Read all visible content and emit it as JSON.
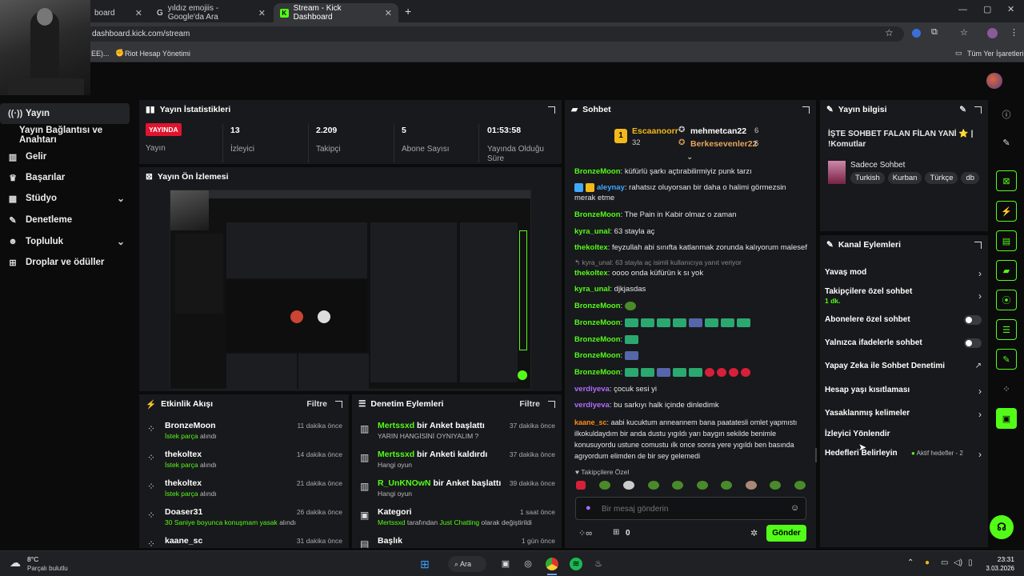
{
  "browser": {
    "tabs": [
      {
        "title": "board"
      },
      {
        "title": "yıldız emojiis - Google'da Ara"
      },
      {
        "title": "Stream - Kick Dashboard"
      }
    ],
    "url": "dashboard.kick.com/stream",
    "bookmarks": [
      "EE)...",
      "Riot Hesap Yönetimi"
    ],
    "bookmarks_right": "Tüm Yer İşaretleri"
  },
  "nav": {
    "items": [
      {
        "label": "Yayın",
        "icon": "broadcast-icon"
      },
      {
        "label": "Yayın Bağlantısı ve Anahtarı",
        "icon": ""
      },
      {
        "label": "Gelir",
        "icon": "chart-icon"
      },
      {
        "label": "Başarılar",
        "icon": "trophy-icon"
      },
      {
        "label": "Stüdyo",
        "icon": "grid-icon"
      },
      {
        "label": "Denetleme",
        "icon": "wrench-icon"
      },
      {
        "label": "Topluluk",
        "icon": "people-icon"
      },
      {
        "label": "Droplar ve ödüller",
        "icon": "gift-icon"
      }
    ]
  },
  "stats": {
    "title": "Yayın İstatistikleri",
    "live_badge": "YAYINDA",
    "live_label": "Yayın",
    "viewers": {
      "value": "13",
      "label": "İzleyici"
    },
    "followers": {
      "value": "2.209",
      "label": "Takipçi"
    },
    "subs": {
      "value": "5",
      "label": "Abone Sayısı"
    },
    "uptime": {
      "value": "01:53:58",
      "label": "Yayında Olduğu Süre"
    }
  },
  "preview": {
    "title": "Yayın Ön İzlemesi"
  },
  "activity": {
    "title": "Etkinlik Akışı",
    "filter": "Filtre",
    "rows": [
      {
        "name": "BronzeMoon",
        "accent": "İstek parça",
        "rest": "alındı",
        "time": "11 dakika önce"
      },
      {
        "name": "thekoltex",
        "accent": "İstek parça",
        "rest": "alındı",
        "time": "14 dakika önce"
      },
      {
        "name": "thekoltex",
        "accent": "İstek parça",
        "rest": "alındı",
        "time": "21 dakika önce"
      },
      {
        "name": "Doaser31",
        "accent": "30 Saniye boyunca konuşmam yasak",
        "rest": "alındı",
        "time": "26 dakika önce"
      },
      {
        "name": "kaane_sc",
        "accent": "",
        "rest": "",
        "time": "31 dakika önce"
      }
    ]
  },
  "moderation": {
    "title": "Denetim Eylemleri",
    "filter": "Filtre",
    "rows": [
      {
        "user": "Mertssxd",
        "action": "bir Anket başlattı",
        "sub": "YARIN HANGİSİNİ OYNIYALIM ?",
        "time": "37 dakika önce"
      },
      {
        "user": "Mertssxd",
        "action": "bir Anketi kaldırdı",
        "sub": "Hangi oyun",
        "time": "37 dakika önce"
      },
      {
        "user": "R_UnKNOwN",
        "action": "bir Anket başlattı",
        "sub": "Hangi oyun",
        "time": "39 dakika önce"
      },
      {
        "user": "",
        "action": "Kategori",
        "sub_user": "Mertssxd",
        "sub_mid": "tarafından",
        "sub_cat": "Just Chatting",
        "sub_end": "olarak değiştirildi",
        "time": "1 saat önce"
      },
      {
        "user": "",
        "action": "Başlık",
        "sub": "",
        "time": "1 gün önce"
      }
    ]
  },
  "chat": {
    "title": "Sohbet",
    "top": [
      {
        "name": "Escaanoorr",
        "count": "32",
        "rank": "1"
      },
      {
        "name": "mehmetcan22",
        "count": "6"
      },
      {
        "name": "Berkesevenler22",
        "count": "6"
      }
    ],
    "messages": [
      {
        "user": "BronzeMoon",
        "color": "#53fc18",
        "text": "küfürlü şarkı açtırabilirmiyiz punk tarzı"
      },
      {
        "user": "aleynay",
        "color": "#3fa9ff",
        "text": "rahatsız oluyorsan bir daha o halimi görmezsin merak etme"
      },
      {
        "user": "BronzeMoon",
        "color": "#53fc18",
        "text": "The Pain in Kabir olmaz o zaman"
      },
      {
        "user": "kyra_unal",
        "color": "#53fc18",
        "text": "63 stayla aç"
      },
      {
        "user": "thekoltex",
        "color": "#53fc18",
        "text": "feyzullah abi sınıfta katlanmak zorunda kalıyorum malesef"
      },
      {
        "user": "",
        "color": "#888",
        "text": "kyra_unal: 63 stayla aç isimli kullanıcıya yanıt veriyor"
      },
      {
        "user": "thekoltex",
        "color": "#53fc18",
        "text": "oooo onda küfürün k sı yok"
      },
      {
        "user": "kyra_unal",
        "color": "#53fc18",
        "text": "djkjasdas"
      },
      {
        "user": "BronzeMoon",
        "color": "#53fc18",
        "text": ""
      },
      {
        "user": "BronzeMoon",
        "color": "#53fc18",
        "text": ""
      },
      {
        "user": "BronzeMoon",
        "color": "#53fc18",
        "text": ""
      },
      {
        "user": "BronzeMoon",
        "color": "#53fc18",
        "text": ""
      },
      {
        "user": "BronzeMoon",
        "color": "#53fc18",
        "text": ""
      },
      {
        "user": "verdiyeva",
        "color": "#b36bff",
        "text": "çocuk sesi yi"
      },
      {
        "user": "verdiyeva",
        "color": "#b36bff",
        "text": "bu sarkıyı halk içinde dinledimk"
      },
      {
        "user": "kaane_sc",
        "color": "#ff8c1a",
        "text": "aabi kucuktum anneannem bana paatatesli omlet yapmıstı ilkokuldaydım bir anda dustu yıgıldı yarı baygın sekilde benimle konusuyordu ustune comustu ılk once sonra yere yıgıldı ben basında agıyordum elimden de bir sey gelemedi"
      }
    ],
    "followers_only": "Takipçilere Özel",
    "input_placeholder": "Bir mesaj gönderin",
    "points": "0",
    "send": "Gönder"
  },
  "stream_info": {
    "title": "Yayın bilgisi",
    "stream_title": "İŞTE SOHBET FALAN FİLAN YANİ ⭐ | !Komutlar",
    "category": "Sadece Sohbet",
    "tags": [
      "Turkish",
      "Kurban",
      "Türkçe",
      "db"
    ]
  },
  "actions": {
    "title": "Kanal Eylemleri",
    "rows": [
      {
        "label": "Yavaş mod",
        "type": "arrow"
      },
      {
        "label": "Takipçilere özel sohbet",
        "sub": "1 dk.",
        "type": "arrow"
      },
      {
        "label": "Abonelere özel sohbet",
        "type": "toggle"
      },
      {
        "label": "Yalnızca ifadelerle sohbet",
        "type": "toggle"
      },
      {
        "label": "Yapay Zeka ile Sohbet Denetimi",
        "type": "ext"
      },
      {
        "label": "Hesap yaşı kısıtlaması",
        "type": "arrow"
      },
      {
        "label": "Yasaklanmış kelimeler",
        "type": "arrow"
      },
      {
        "label": "İzleyici Yönlendir",
        "type": "none"
      },
      {
        "label": "Hedefleri Belirleyin",
        "type": "arrow",
        "badge": "Aktif hedefler - 2"
      }
    ]
  },
  "taskbar": {
    "weather_temp": "8°C",
    "weather_desc": "Parçalı bulutlu",
    "search": "Ara",
    "time": "23:31",
    "date": "3.03.2026"
  },
  "colors": {
    "accent": "#53fc18",
    "panel": "#18191c",
    "live": "#e0142e"
  }
}
